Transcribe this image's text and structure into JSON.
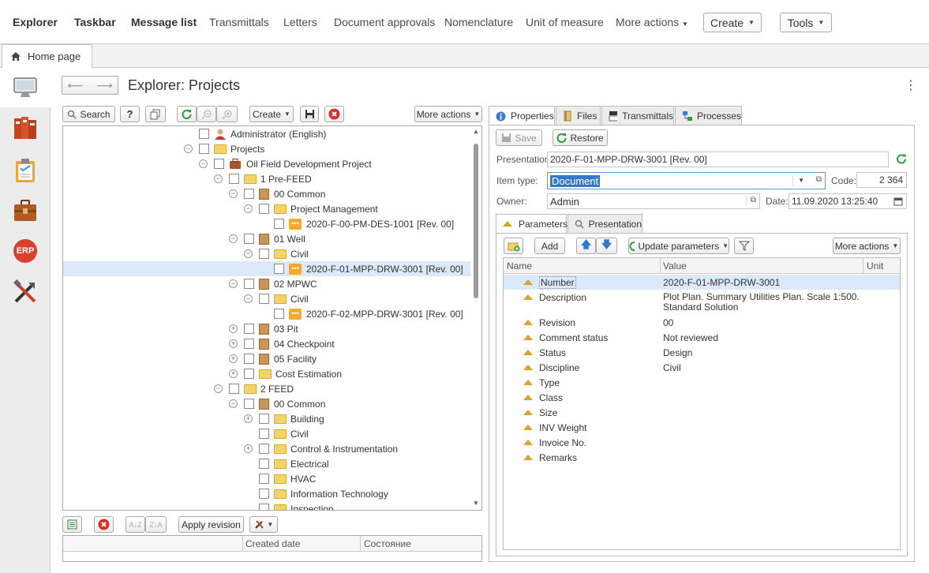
{
  "nav": {
    "explorer": "Explorer",
    "taskbar": "Taskbar",
    "message_list": "Message list",
    "transmittals": "Transmittals",
    "letters": "Letters",
    "document_approvals": "Document approvals",
    "nomenclature": "Nomenclature",
    "unit_of_measure": "Unit of measure",
    "more_actions": "More actions",
    "create": "Create",
    "tools": "Tools"
  },
  "tabs": {
    "home": "Home page"
  },
  "sidebar": {
    "erp": "ERP"
  },
  "page": {
    "title": "Explorer: Projects",
    "kebab": "⋮"
  },
  "tree_toolbar": {
    "search": "Search",
    "help": "?",
    "create": "Create",
    "more_actions": "More actions"
  },
  "tree": [
    {
      "label": "Administrator (English)"
    },
    {
      "label": "Projects"
    },
    {
      "label": "Oil Field Development Project"
    },
    {
      "label": "1 Pre-FEED"
    },
    {
      "label": "00 Common"
    },
    {
      "label": "Project Management"
    },
    {
      "label": "2020-F-00-PM-DES-1001 [Rev. 00]"
    },
    {
      "label": "01 Well"
    },
    {
      "label": "Civil"
    },
    {
      "label": "2020-F-01-MPP-DRW-3001 [Rev. 00]"
    },
    {
      "label": "02 MPWC"
    },
    {
      "label": "Civil"
    },
    {
      "label": "2020-F-02-MPP-DRW-3001 [Rev. 00]"
    },
    {
      "label": "03 Pit"
    },
    {
      "label": "04 Checkpoint"
    },
    {
      "label": "05 Facility"
    },
    {
      "label": "Cost Estimation"
    },
    {
      "label": "2 FEED"
    },
    {
      "label": "00 Common"
    },
    {
      "label": "Building"
    },
    {
      "label": "Civil"
    },
    {
      "label": "Control & Instrumentation"
    },
    {
      "label": "Electrical"
    },
    {
      "label": "HVAC"
    },
    {
      "label": "Information Technology"
    },
    {
      "label": "Inspection"
    }
  ],
  "bottom": {
    "apply_revision": "Apply revision",
    "columns": [
      "Created date",
      "Состояние"
    ]
  },
  "right_tabs": {
    "properties": "Properties",
    "files": "Files",
    "transmittals": "Transmittals",
    "processes": "Processes"
  },
  "form": {
    "save": "Save",
    "restore": "Restore",
    "presentation_label": "Presentation:",
    "presentation": "2020-F-01-MPP-DRW-3001 [Rev. 00]",
    "item_type_label": "Item type:",
    "item_type": "Document",
    "code_label": "Code:",
    "code": "2 364",
    "owner_label": "Owner:",
    "owner": "Admin",
    "date_label": "Date:",
    "date": "11.09.2020 13:25:40"
  },
  "sub_tabs": {
    "parameters": "Parameters",
    "presentation": "Presentation"
  },
  "param_toolbar": {
    "add": "Add",
    "update": "Update parameters",
    "more_actions": "More actions"
  },
  "param_columns": {
    "name": "Name",
    "value": "Value",
    "unit": "Unit"
  },
  "params": [
    {
      "name": "Number",
      "value": "2020-F-01-MPP-DRW-3001"
    },
    {
      "name": "Description",
      "value": "Plot Plan. Summary Utilities Plan. Scale 1:500.",
      "value2": "Standard Solution"
    },
    {
      "name": "Revision",
      "value": "00"
    },
    {
      "name": "Comment status",
      "value": "Not reviewed"
    },
    {
      "name": "Status",
      "value": "Design"
    },
    {
      "name": "Discipline",
      "value": "Civil"
    },
    {
      "name": "Type",
      "value": ""
    },
    {
      "name": "Class",
      "value": ""
    },
    {
      "name": "Size",
      "value": ""
    },
    {
      "name": "INV Weight",
      "value": ""
    },
    {
      "name": "Invoice No.",
      "value": ""
    },
    {
      "name": "Remarks",
      "value": ""
    }
  ]
}
